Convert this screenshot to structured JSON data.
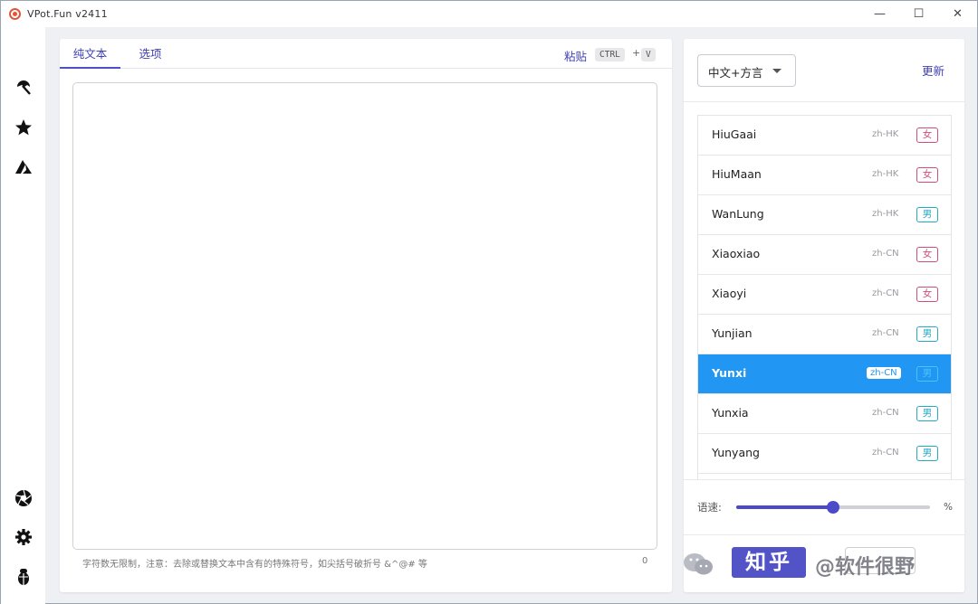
{
  "window": {
    "title": "VPot.Fun v2411",
    "minimize": "—",
    "maximize": "☐",
    "close": "✕"
  },
  "sidebar": {
    "items": [
      {
        "icon": "umbrella-icon",
        "glyph": "☂"
      },
      {
        "icon": "star-icon",
        "glyph": "★"
      },
      {
        "icon": "azure-icon",
        "glyph": "▲"
      },
      {
        "icon": "aperture-icon",
        "glyph": "✺"
      },
      {
        "icon": "gear-icon",
        "glyph": "⚙"
      },
      {
        "icon": "bug-icon",
        "glyph": "🐞"
      }
    ]
  },
  "editor": {
    "tabs": [
      {
        "label": "纯文本",
        "active": true
      },
      {
        "label": "选项",
        "active": false
      }
    ],
    "paste_label": "粘贴",
    "kbd_ctrl": "CTRL",
    "kbd_plus": "+",
    "kbd_v": "V",
    "text_value": "",
    "hint": "字符数无限制，注意：去除或替换文本中含有的特殊符号，如尖括号破折号 &^@# 等",
    "char_count": "0"
  },
  "voices": {
    "language": "中文+方言",
    "update_label": "更新",
    "list": [
      {
        "name": "HiuGaai",
        "locale": "zh-HK",
        "gender": "女",
        "kind": "f",
        "selected": false
      },
      {
        "name": "HiuMaan",
        "locale": "zh-HK",
        "gender": "女",
        "kind": "f",
        "selected": false
      },
      {
        "name": "WanLung",
        "locale": "zh-HK",
        "gender": "男",
        "kind": "m",
        "selected": false
      },
      {
        "name": "Xiaoxiao",
        "locale": "zh-CN",
        "gender": "女",
        "kind": "f",
        "selected": false
      },
      {
        "name": "Xiaoyi",
        "locale": "zh-CN",
        "gender": "女",
        "kind": "f",
        "selected": false
      },
      {
        "name": "Yunjian",
        "locale": "zh-CN",
        "gender": "男",
        "kind": "m",
        "selected": false
      },
      {
        "name": "Yunxi",
        "locale": "zh-CN",
        "gender": "男",
        "kind": "m",
        "selected": true
      },
      {
        "name": "Yunxia",
        "locale": "zh-CN",
        "gender": "男",
        "kind": "m",
        "selected": false
      },
      {
        "name": "Yunyang",
        "locale": "zh-CN",
        "gender": "男",
        "kind": "m",
        "selected": false
      }
    ],
    "speed_label": "语速:",
    "speed_value": 0.5,
    "speed_unit": "%"
  },
  "watermark": {
    "zhihu": "知乎",
    "author": "@软件很野"
  },
  "colors": {
    "accent": "#4b4bc9",
    "selected_row": "#2196f3",
    "female": "#d04e7a",
    "male": "#27a9bf"
  }
}
